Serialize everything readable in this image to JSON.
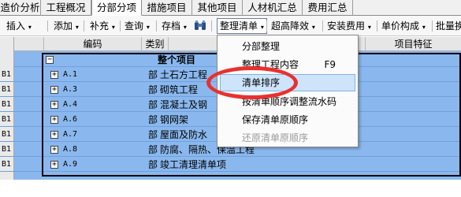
{
  "tabs": [
    "造价分析",
    "工程概况",
    "分部分项",
    "措施项目",
    "其他项目",
    "人材机汇总",
    "费用汇总"
  ],
  "active_tab": "分部分项",
  "toolbar": {
    "insert": "插入",
    "add": "添加",
    "supplement": "补充",
    "query": "查询",
    "save": "存档",
    "organize_list": "整理清单",
    "elevated_reduction": "超高降效",
    "install_cost": "安装费用",
    "unit_composition": "单价构成",
    "batch_replace": "批量换"
  },
  "table": {
    "headers": {
      "code": "编码",
      "category": "类别",
      "feature": "项目特征"
    },
    "root_row": {
      "collapse": "−",
      "name": "整个项目"
    },
    "rows": [
      {
        "id": "B1",
        "code": "A.1",
        "category": "部",
        "name": "土石方工程"
      },
      {
        "id": "B1",
        "code": "A.3",
        "category": "部",
        "name": "砌筑工程"
      },
      {
        "id": "B1",
        "code": "A.4",
        "category": "部",
        "name": "混凝土及钢"
      },
      {
        "id": "B1",
        "code": "A.6",
        "category": "部",
        "name": "钢网架"
      },
      {
        "id": "B1",
        "code": "A.7",
        "category": "部",
        "name": "屋面及防水"
      },
      {
        "id": "B1",
        "code": "A.8",
        "category": "部",
        "name": "防腐、隔热、保温工程"
      },
      {
        "id": "B1",
        "code": "A.9",
        "category": "部",
        "name": "竣工清理清单项"
      }
    ]
  },
  "menu": {
    "items": [
      {
        "label": "分部整理",
        "shortcut": "",
        "state": "normal"
      },
      {
        "label": "整理工程内容",
        "shortcut": "F9",
        "state": "normal"
      },
      {
        "label": "清单排序",
        "shortcut": "",
        "state": "highlight"
      },
      {
        "label": "按清单顺序调整流水码",
        "shortcut": "",
        "state": "normal"
      },
      {
        "label": "保存清单原顺序",
        "shortcut": "",
        "state": "normal"
      },
      {
        "label": "还原清单原顺序",
        "shortcut": "",
        "state": "disabled"
      }
    ]
  },
  "colors": {
    "selection": "#8ab8ee",
    "annotation": "#e8312f",
    "menu_highlight": "#cde4fb"
  },
  "icons": [
    "binoculars-icon",
    "dropdown-arrow-icon",
    "plus-expand-icon",
    "minus-collapse-icon"
  ]
}
